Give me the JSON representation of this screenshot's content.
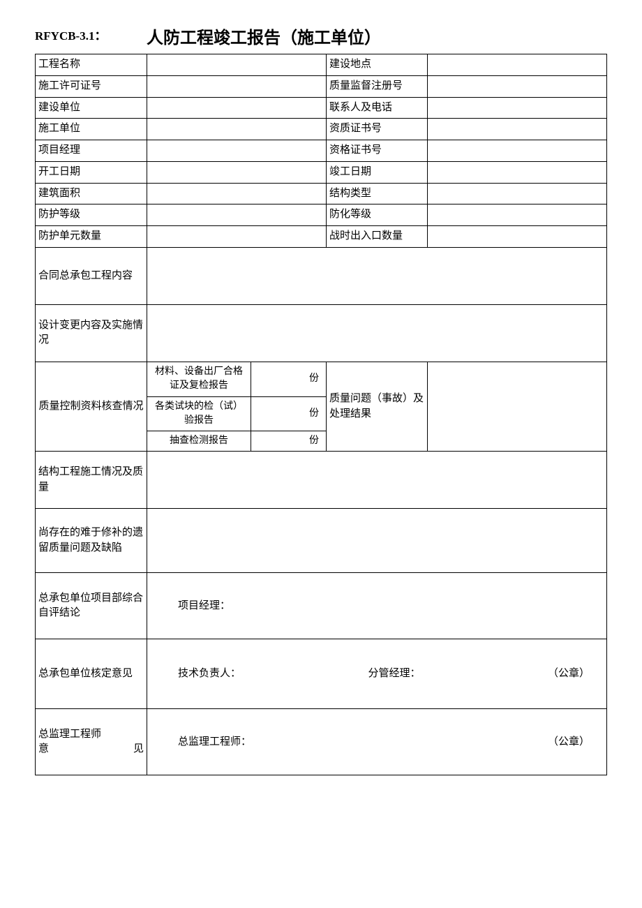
{
  "form_code": "RFYCB-3.1：",
  "title": "人防工程竣工报告（施工单位）",
  "labels": {
    "project_name": "工程名称",
    "construction_site": "建设地点",
    "permit_no": "施工许可证号",
    "quality_reg_no": "质量监督注册号",
    "build_unit": "建设单位",
    "contact_phone": "联系人及电话",
    "construct_unit": "施工单位",
    "qualification_cert": "资质证书号",
    "pm": "项目经理",
    "qualif_cert2": "资格证书号",
    "start_date": "开工日期",
    "end_date": "竣工日期",
    "building_area": "建筑面积",
    "structure_type": "结构类型",
    "protection_grade": "防护等级",
    "chemical_grade": "防化等级",
    "protection_units": "防护单元数量",
    "wartime_entrances": "战时出入口数量",
    "contract_scope": "合同总承包工程内容",
    "design_change": "设计变更内容及实施情况",
    "quality_review": "质量控制资料核查情况",
    "material_cert": "材料、设备出厂合格证及复检报告",
    "test_block": "各类试块的检（试）验报告",
    "spot_check": "抽查检测报告",
    "copies_unit": "份",
    "quality_issue": "质量问题（事故）及处理结果",
    "structure_quality": "结构工程施工情况及质量",
    "remaining_defects": "尚存在的难于修补的遗留质量问题及缺陷",
    "contractor_self_eval": "总承包单位项目部综合自评结论",
    "contractor_approval": "总承包单位核定意见",
    "chief_engineer_opinion_1": "总监理工程师",
    "chief_engineer_opinion_2a": "意",
    "chief_engineer_opinion_2b": "见",
    "pm_sig": "项目经理：",
    "tech_lead": "技术负责人：",
    "deputy_mgr": "分管经理：",
    "seal": "（公章）",
    "chief_eng_sig": "总监理工程师："
  },
  "values": {
    "project_name": "",
    "construction_site": "",
    "permit_no": "",
    "quality_reg_no": "",
    "build_unit": "",
    "contact_phone": "",
    "construct_unit": "",
    "qualification_cert": "",
    "pm": "",
    "qualif_cert2": "",
    "start_date": "",
    "end_date": "",
    "building_area": "",
    "structure_type": "",
    "protection_grade": "",
    "chemical_grade": "",
    "protection_units": "",
    "wartime_entrances": "",
    "contract_scope": "",
    "design_change": "",
    "material_cert_copies": "",
    "test_block_copies": "",
    "spot_check_copies": "",
    "quality_issue": "",
    "structure_quality": "",
    "remaining_defects": "",
    "contractor_self_eval": "",
    "contractor_approval": "",
    "chief_engineer_opinion": ""
  }
}
